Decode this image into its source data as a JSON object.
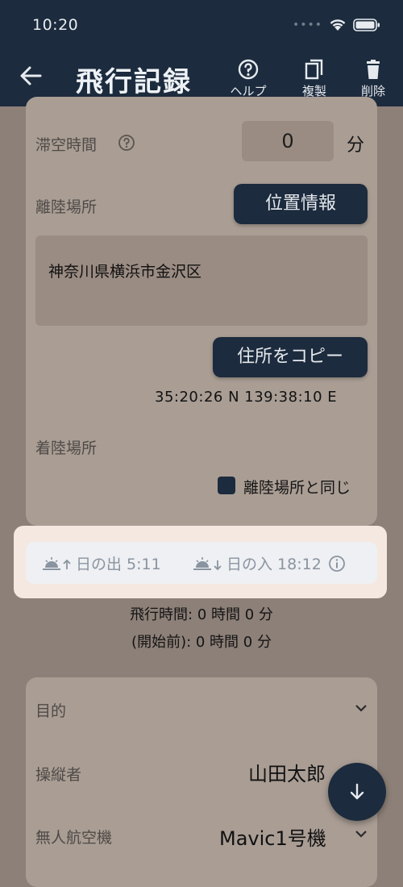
{
  "status": {
    "time": "10:20"
  },
  "appbar": {
    "title": "飛行記録",
    "actions": {
      "help": "ヘルプ",
      "duplicate": "複製",
      "delete": "削除"
    }
  },
  "form": {
    "hover_time": {
      "label": "滞空時間",
      "value": "0",
      "unit": "分"
    },
    "takeoff": {
      "label": "離陸場所",
      "location_button": "位置情報",
      "address": "神奈川県横浜市金沢区",
      "copy_button": "住所をコピー",
      "coordinates": "35:20:26 N 139:38:10 E"
    },
    "landing": {
      "label": "着陸場所",
      "same_checkbox_label": "離陸場所と同じ"
    }
  },
  "sun": {
    "sunrise": "日の出 5:11",
    "sunset": "日の入 18:12"
  },
  "flight_time": {
    "line1": "飛行時間: 0 時間 0 分",
    "line2": "(開始前): 0 時間 0 分"
  },
  "details": {
    "purpose_label": "目的",
    "operator_label": "操縦者",
    "operator_value": "山田太郎",
    "aircraft_label": "無人航空機",
    "aircraft_value": "Mavic1号機"
  },
  "colors": {
    "navy": "#1c2b3d",
    "dim_bg": "#8d8078",
    "card": "#a99d94",
    "highlight": "#f4e8e0"
  }
}
